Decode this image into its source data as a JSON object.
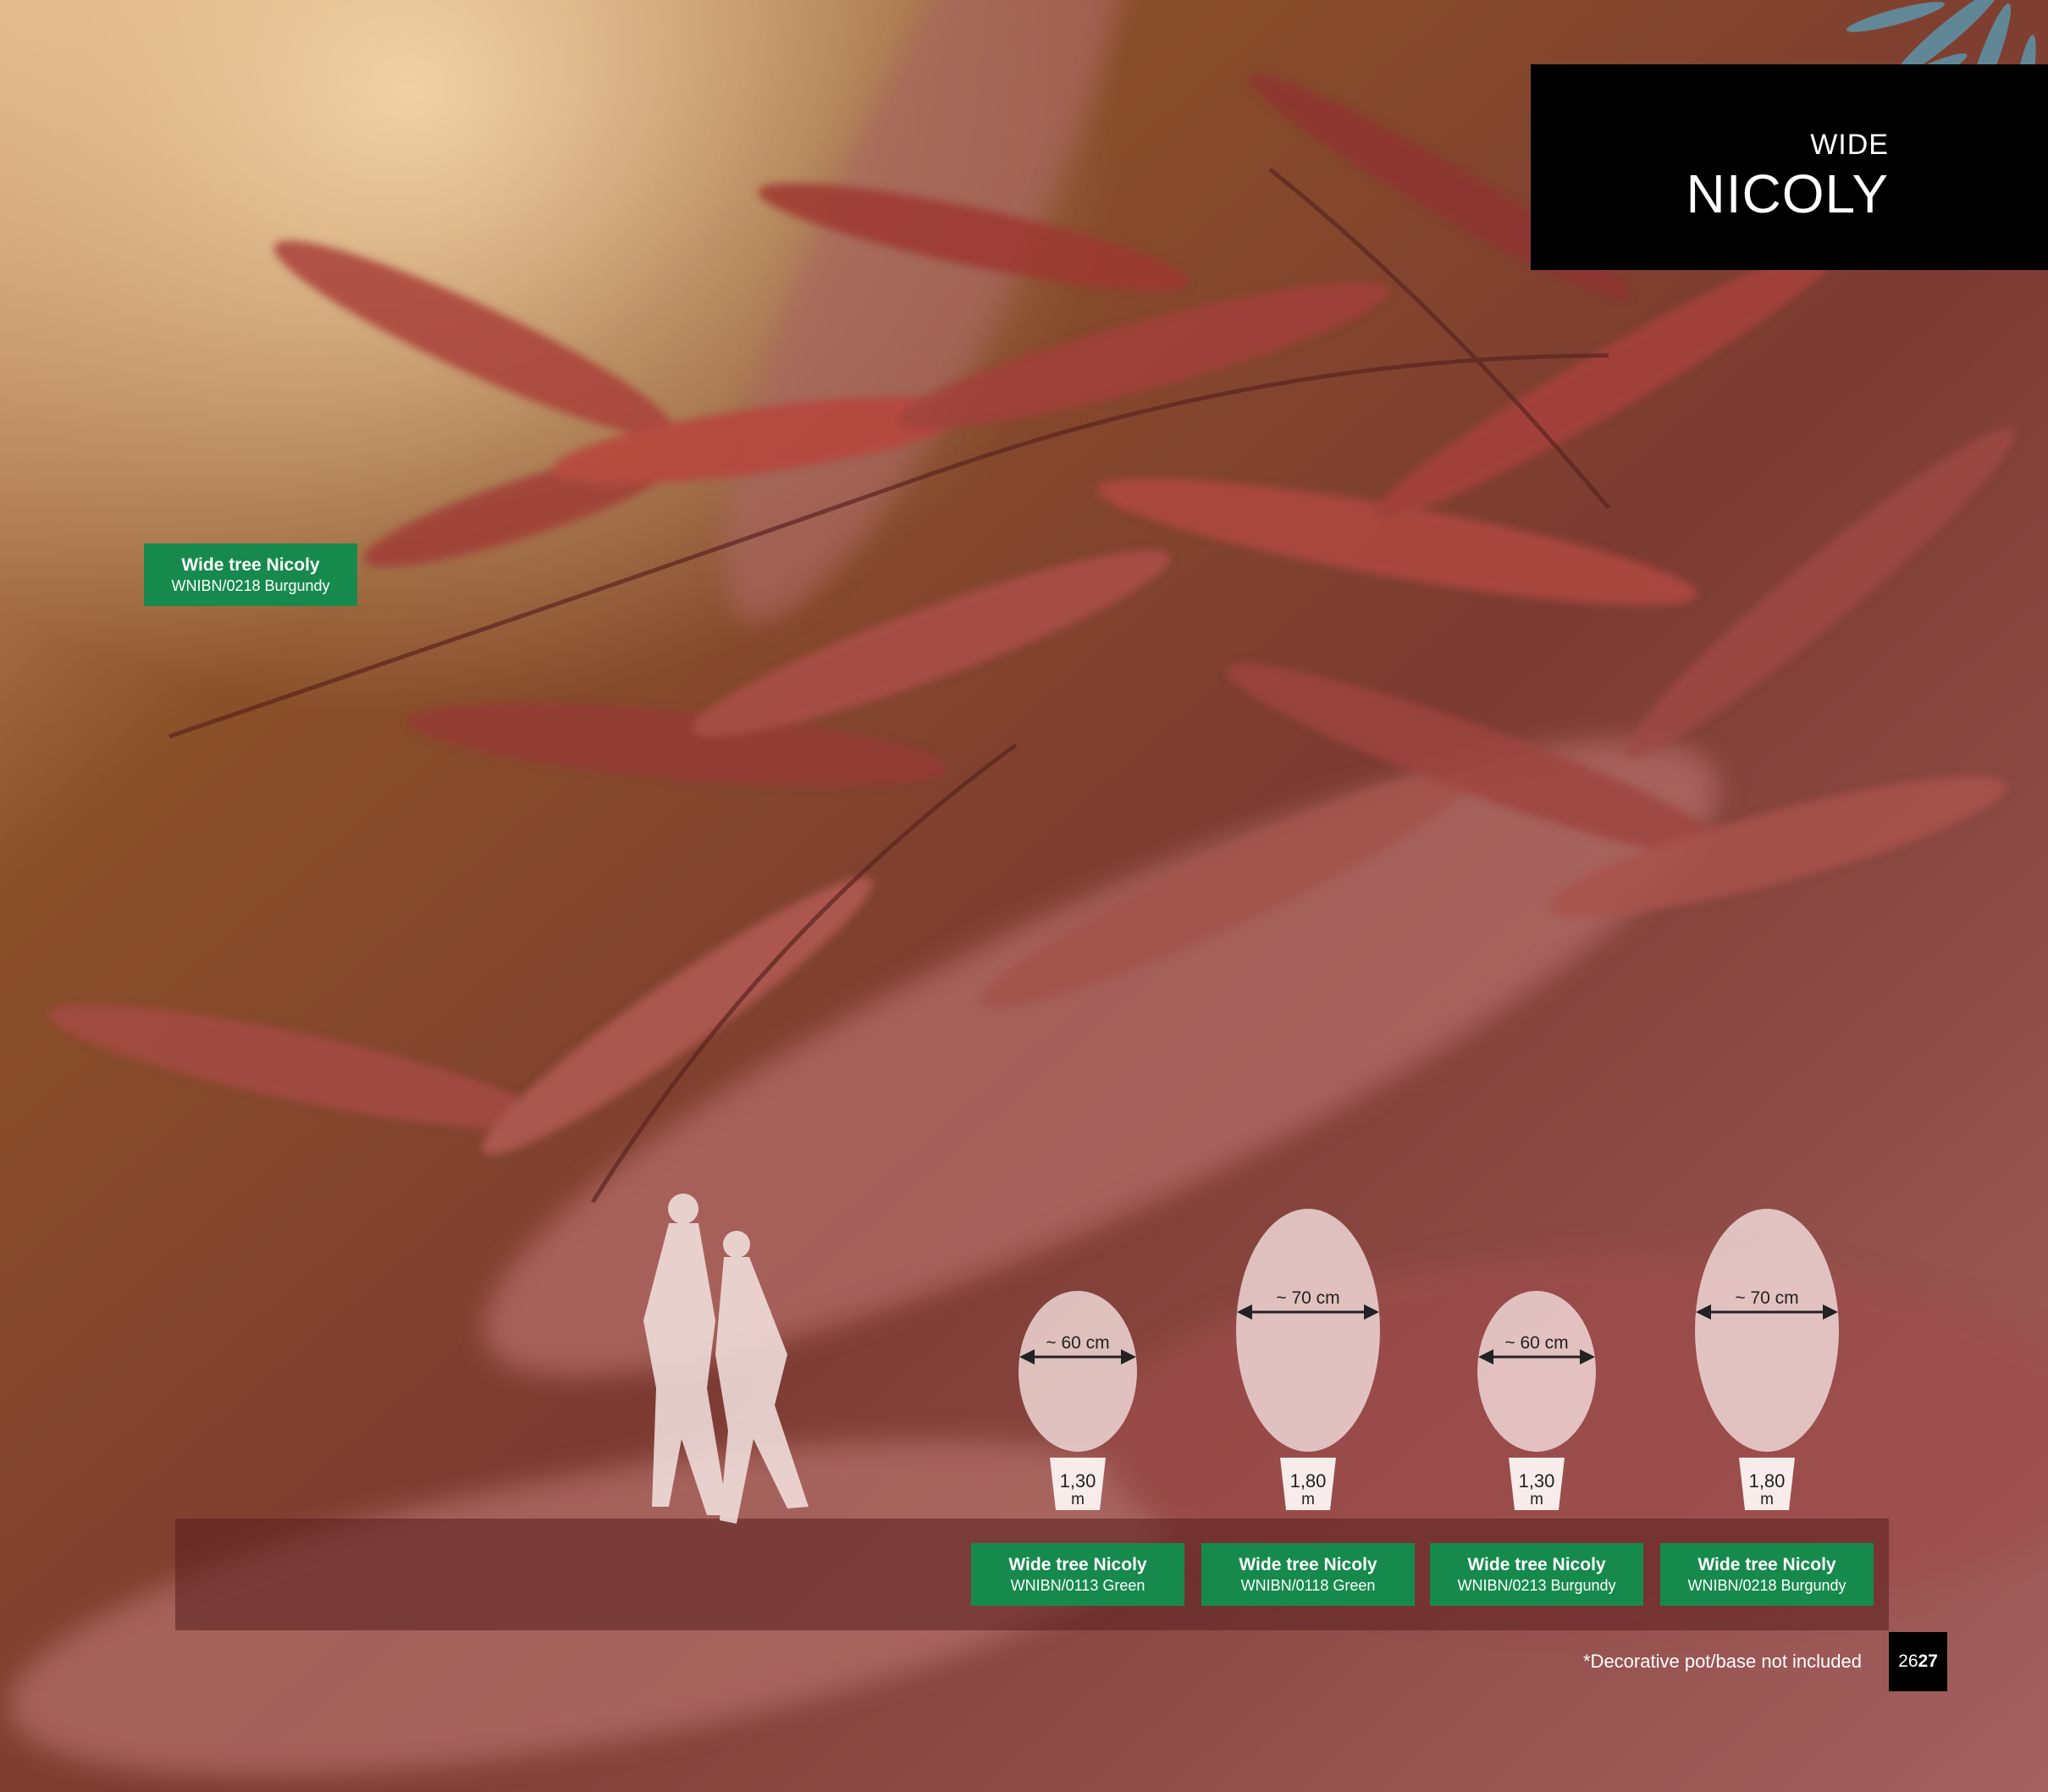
{
  "title": {
    "small": "WIDE",
    "big": "NICOLY"
  },
  "main_label": {
    "name": "Wide tree Nicoly",
    "code": "WNIBN/0218 Burgundy"
  },
  "products": [
    {
      "name": "Wide tree Nicoly",
      "code": "WNIBN/0113 Green",
      "width": "~ 60 cm",
      "height": "1,30",
      "unit": "m"
    },
    {
      "name": "Wide tree Nicoly",
      "code": "WNIBN/0118 Green",
      "width": "~ 70 cm",
      "height": "1,80",
      "unit": "m"
    },
    {
      "name": "Wide tree Nicoly",
      "code": "WNIBN/0213 Burgundy",
      "width": "~ 60 cm",
      "height": "1,30",
      "unit": "m"
    },
    {
      "name": "Wide tree Nicoly",
      "code": "WNIBN/0218 Burgundy",
      "width": "~ 70 cm",
      "height": "1,80",
      "unit": "m"
    }
  ],
  "footnote": "*Decorative pot/base not included",
  "page": {
    "left": "26",
    "right": "27"
  },
  "colors": {
    "tag_green": "#168a4d",
    "leaf_red": "#a84a44",
    "background_brown": "#7a4523"
  }
}
